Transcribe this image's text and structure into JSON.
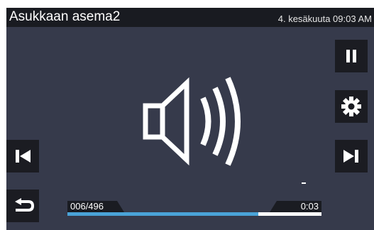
{
  "header": {
    "title": "Asukkaan asema2",
    "datetime": "4. kesäkuuta 09:03 AM"
  },
  "player": {
    "track_counter": "006/496",
    "elapsed_time": "0:03",
    "progress_fraction": 0.75
  },
  "icons": {
    "center": "speaker-volume-icon",
    "pause": "pause-icon",
    "settings": "gear-icon",
    "previous": "skip-previous-icon",
    "next": "skip-next-icon",
    "back": "back-arrow-icon"
  },
  "colors": {
    "background": "#363a4b",
    "titlebar": "#191b21",
    "button": "#1b1c22",
    "progress": "#4aa3d8",
    "track": "#ffffff"
  }
}
